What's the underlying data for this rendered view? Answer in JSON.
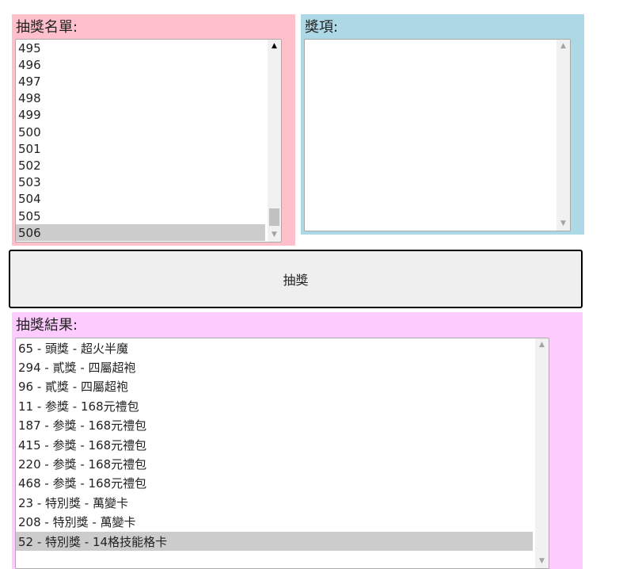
{
  "participants": {
    "label": "抽獎名單:",
    "items": [
      "495",
      "496",
      "497",
      "498",
      "499",
      "500",
      "501",
      "502",
      "503",
      "504",
      "505",
      "506"
    ],
    "selected_index": 11,
    "colors": {
      "panel_bg": "#ffc0cb"
    }
  },
  "prizes": {
    "label": "獎項:",
    "items": [],
    "colors": {
      "panel_bg": "#add8e6"
    }
  },
  "draw_button": {
    "label": "抽獎"
  },
  "results": {
    "label": "抽獎結果:",
    "items": [
      "65 - 頭獎 - 超火半魔",
      "294 - 貳獎 - 四屬超袍",
      "96 - 貳獎 - 四屬超袍",
      "11 - 参獎 - 168元禮包",
      "187 - 参獎 - 168元禮包",
      "415 - 参獎 - 168元禮包",
      "220 - 参獎 - 168元禮包",
      "468 - 参獎 - 168元禮包",
      "23 - 特別獎 - 萬變卡",
      "208 - 特別獎 - 萬變卡",
      "52 - 特別獎 - 14格技能格卡"
    ],
    "selected_index": 10,
    "colors": {
      "panel_bg": "#ffccff"
    }
  },
  "icons": {
    "scroll_up": "▲",
    "scroll_down": "▼"
  }
}
